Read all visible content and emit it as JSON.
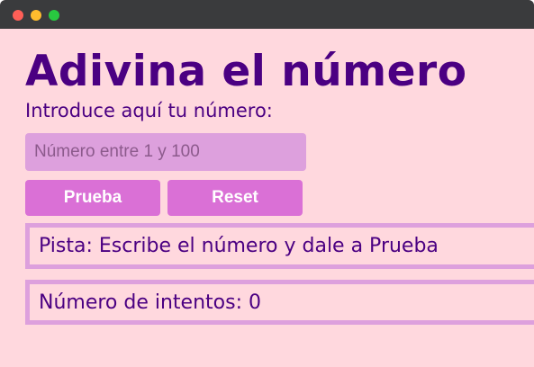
{
  "window": {
    "controls": [
      "close",
      "minimize",
      "maximize"
    ]
  },
  "page": {
    "title": "Adivina el número",
    "instruction": "Introduce aquí tu número:"
  },
  "guess_input": {
    "value": "",
    "placeholder": "Número entre 1 y 100"
  },
  "buttons": {
    "guess_label": "Prueba",
    "reset_label": "Reset"
  },
  "hint": {
    "text": "Pista: Escribe el número y dale a Prueba"
  },
  "attempts": {
    "text": "Número de intentos: 0"
  },
  "colors": {
    "background": "#ffd8de",
    "text": "#4b0082",
    "input_bg": "#dda0dd",
    "button_bg": "#da70d6",
    "panel_border": "#dda0dd",
    "titlebar": "#3a3b3d"
  }
}
